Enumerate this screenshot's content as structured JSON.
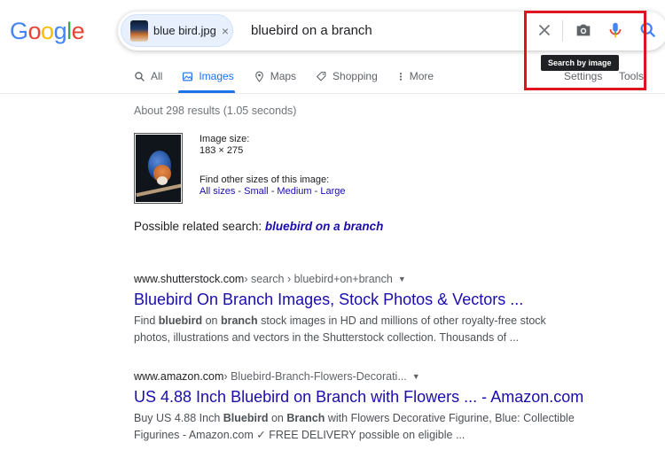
{
  "logo": {
    "text": "Google",
    "letters": [
      "G",
      "o",
      "o",
      "g",
      "l",
      "e"
    ],
    "colors": [
      "#4285F4",
      "#EA4335",
      "#FBBC05",
      "#4285F4",
      "#34A853",
      "#EA4335"
    ]
  },
  "search": {
    "chip_label": "blue bird.jpg",
    "chip_close": "×",
    "query": "bluebird on a branch",
    "tooltip": "Search by image",
    "icons": [
      "close-icon",
      "camera-icon",
      "mic-icon",
      "search-icon"
    ]
  },
  "tabs": [
    {
      "label": "All",
      "icon": "search-icon",
      "active": false
    },
    {
      "label": "Images",
      "icon": "image-icon",
      "active": true
    },
    {
      "label": "Maps",
      "icon": "map-pin-icon",
      "active": false
    },
    {
      "label": "Shopping",
      "icon": "tag-icon",
      "active": false
    },
    {
      "label": "More",
      "icon": "more-vert-icon",
      "active": false
    }
  ],
  "settings_label": "Settings",
  "tools_label": "Tools",
  "stats": "About 298 results (1.05 seconds)",
  "image_info": {
    "size_label": "Image size:",
    "size_value": "183 × 275",
    "other_sizes_label": "Find other sizes of this image:",
    "sizes": [
      "All sizes",
      "Small",
      "Medium",
      "Large"
    ],
    "separator": " - "
  },
  "related": {
    "prefix": "Possible related search: ",
    "query": "bluebird on a branch"
  },
  "results": [
    {
      "domain": "www.shutterstock.com",
      "path": " › search › bluebird+on+branch",
      "title": "Bluebird On Branch Images, Stock Photos & Vectors ...",
      "snippet_1a": "Find ",
      "snippet_1b": "bluebird",
      "snippet_1c": " on ",
      "snippet_1d": "branch",
      "snippet_1e": " stock images in HD and millions of other royalty-free stock",
      "snippet_2": "photos, illustrations and vectors in the Shutterstock collection. Thousands of ..."
    },
    {
      "domain": "www.amazon.com",
      "path": " › Bluebird-Branch-Flowers-Decorati...",
      "title": "US 4.88 Inch Bluebird on Branch with Flowers ... - Amazon.com",
      "snippet_1a": "Buy US 4.88 Inch ",
      "snippet_1b": "Bluebird",
      "snippet_1c": " on ",
      "snippet_1d": "Branch",
      "snippet_1e": " with Flowers Decorative Figurine, Blue: Collectible",
      "snippet_2": "Figurines - Amazon.com ✓ FREE DELIVERY possible on eligible ..."
    }
  ],
  "colors": {
    "link": "#1a0dab",
    "accent": "#1a73e8",
    "highlight": "#e0141e"
  }
}
